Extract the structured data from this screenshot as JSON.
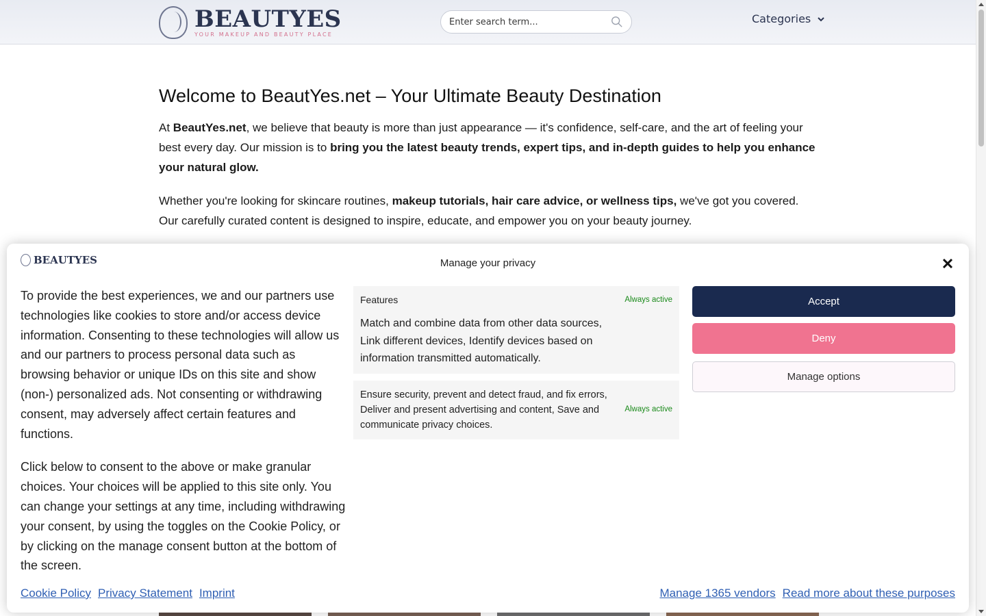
{
  "header": {
    "logo_text": "BEAUTYES",
    "logo_tagline": "YOUR MAKEUP AND BEAUTY PLACE",
    "search": {
      "placeholder": "Enter search term..."
    },
    "categories_label": "Categories"
  },
  "article": {
    "title": "Welcome to BeautYes.net – Your Ultimate Beauty Destination",
    "p1": {
      "a": "At ",
      "b": "BeautYes.net",
      "c": ", we believe that beauty is more than just appearance — it's confidence, self-care, and the art of feeling your best every day. Our mission is to ",
      "d": "bring you the latest beauty trends, expert tips, and in-depth guides to help you enhance your natural glow."
    },
    "p2": {
      "a": "Whether you're looking for skincare routines, ",
      "b": "makeup tutorials, hair care advice, or wellness tips,",
      "c": " we've got you covered. Our carefully curated content is designed to inspire, educate, and empower you on your beauty journey."
    }
  },
  "consent": {
    "logo_text": "BEAUTYES",
    "title": "Manage your privacy",
    "text1": "To provide the best experiences, we and our partners use technologies like cookies to store and/or access device information. Consenting to these technologies will allow us and our partners to process personal data such as browsing behavior or unique IDs on this site and show (non-) personalized ads. Not consenting or withdrawing consent, may adversely affect certain features and functions.",
    "text2": "Click below to consent to the above or make granular choices. Your choices will be applied to this site only. You can change your settings at any time, including withdrawing your consent, by using the toggles on the Cookie Policy, or by clicking on the manage consent button at the bottom of the screen.",
    "purposes": [
      {
        "title": "Features",
        "status": "Always active",
        "description": "Match and combine data from other data sources, Link different devices, Identify devices based on information transmitted automatically."
      },
      {
        "title": "",
        "status": "Always active",
        "description": "Ensure security, prevent and detect fraud, and fix errors, Deliver and present advertising and content, Save and communicate privacy choices."
      }
    ],
    "buttons": {
      "accept": "Accept",
      "deny": "Deny",
      "manage": "Manage options"
    },
    "links_left": [
      "Cookie Policy",
      "Privacy Statement",
      "Imprint"
    ],
    "links_right": [
      "Manage 1365 vendors",
      "Read more about these purposes"
    ]
  },
  "colors": {
    "brand_navy": "#1a2a4f",
    "brand_pink": "#f07390",
    "link_blue": "#2f5fb3",
    "active_green": "#1a8a1a"
  }
}
